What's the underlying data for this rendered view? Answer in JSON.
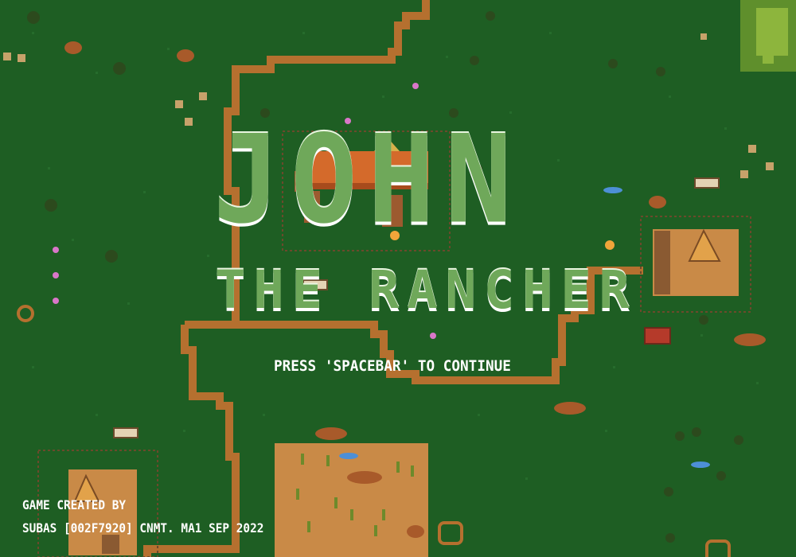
{
  "game": {
    "title_main": "JOHN",
    "title_sub": "THE RANCHER",
    "prompt": "PRESS 'SPACEBAR' TO CONTINUE",
    "credit_line_1": "GAME CREATED BY",
    "credit_line_2": "SUBAS [002F7920] CNMT. MA1 SEP 2022"
  },
  "palette": {
    "grass": "#1e5e23",
    "path": "#b5702f",
    "dirt": "#c98a47",
    "title": "#6fa85a"
  }
}
